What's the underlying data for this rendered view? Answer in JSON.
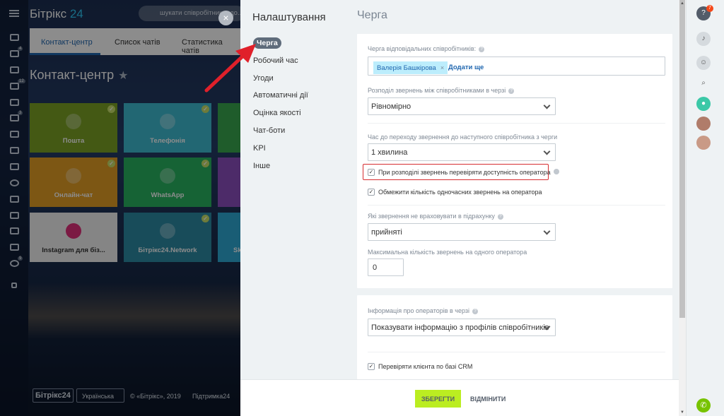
{
  "background": {
    "logo_text": "Бітрікс",
    "logo_num": "24",
    "search_placeholder": "шукати співробітника, до...",
    "tabs": [
      "Контакт-центр",
      "Список чатів",
      "Статистика чатів"
    ],
    "page_title": "Контакт-центр",
    "sidebar_badges": [
      "4",
      "12",
      "3",
      "9"
    ],
    "tiles": [
      {
        "label": "Пошта",
        "color": "#7ca326",
        "checked": true
      },
      {
        "label": "Телефонія",
        "color": "#3fbcd1",
        "checked": true
      },
      {
        "label": "Онлайн-чат",
        "color": "#e49f26",
        "checked": true
      },
      {
        "label": "WhatsApp",
        "color": "#28b462",
        "checked": true
      },
      {
        "label": "Instagram для біз...",
        "color": "#f2f2f2",
        "checked": false
      },
      {
        "label": "Бітрікс24.Network",
        "color": "#2c8aa5",
        "checked": true
      },
      {
        "label": "Sk",
        "color": "#2ea9d6",
        "checked": false
      }
    ],
    "footer": {
      "logo": "Бітрікс24",
      "language": "Українська",
      "copyright": "© «Бітрікс», 2019",
      "support": "Підтримка24"
    }
  },
  "panel": {
    "title": "Налаштування",
    "menu": [
      "Черга",
      "Робочий час",
      "Угоди",
      "Автоматичні дії",
      "Оцінка якості",
      "Чат-боти",
      "KPI",
      "Інше"
    ],
    "active_menu": "Черга",
    "content_title": "Черга",
    "queue_label": "Черга відповідальних співробітників:",
    "queue_user": "Валерія Башкірова",
    "queue_add": "Додати ще",
    "distribution_label": "Розподіл звернень між співробітниками в черзі",
    "distribution_value": "Рівномірно",
    "time_label": "Час до переходу звернення до наступного співробітника з черги",
    "time_value": "1 хвилина",
    "check_availability": {
      "label": "При розподілі звернень перевіряти доступність оператора",
      "checked": true
    },
    "limit_requests": {
      "label": "Обмежити кількість одночасних звернень на оператора",
      "checked": true
    },
    "not_count_label": "Які звернення не враховувати в підрахунку",
    "not_count_value": "прийняті",
    "max_label": "Максимальна кількість звернень на одного оператора",
    "max_value": "0",
    "operator_info_label": "Інформація про операторів в черзі",
    "operator_info_value": "Показувати інформацію з профілів співробітників",
    "crm_check": {
      "label": "Перевіряти клієнта по базі CRM",
      "checked": true
    },
    "save_label": "ЗБЕРЕГТИ",
    "cancel_label": "ВІДМІНИТИ"
  },
  "rightbar": {
    "help_badge": "7"
  },
  "colors": {
    "accent": "#2067b0",
    "save_button": "#bbed21",
    "highlight": "#d62d30",
    "arrow": "#e0202a"
  }
}
